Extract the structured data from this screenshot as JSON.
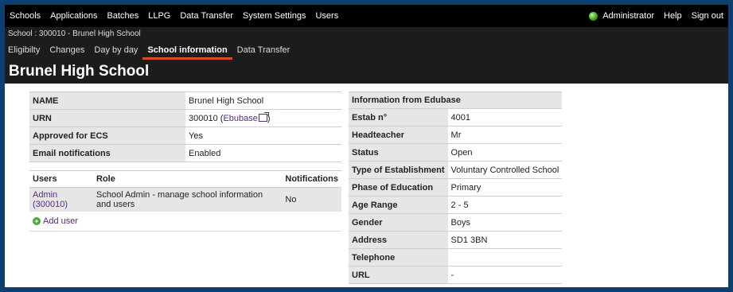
{
  "topnav": {
    "items": [
      "Schools",
      "Applications",
      "Batches",
      "LLPG",
      "Data Transfer",
      "System Settings",
      "Users"
    ],
    "user": "Administrator",
    "help": "Help",
    "signout": "Sign out"
  },
  "breadcrumb": "School : 300010 - Brunel High School",
  "tabs": [
    "Eligibilty",
    "Changes",
    "Day by day",
    "School information",
    "Data Transfer"
  ],
  "active_tab": "School information",
  "page_title": "Brunel High School",
  "school_info": [
    {
      "label": "NAME",
      "value": "Brunel High School"
    },
    {
      "label": "URN",
      "value": "300010"
    },
    {
      "label": "Approved for ECS",
      "value": "Yes"
    },
    {
      "label": "Email notifications",
      "value": "Enabled"
    }
  ],
  "urn_link": "Ebubase",
  "users_table": {
    "headers": [
      "Users",
      "Role",
      "Notifications"
    ],
    "rows": [
      {
        "user": "Admin (300010)",
        "role": "School Admin - manage school information and users",
        "notifications": "No"
      }
    ],
    "add_user": "Add user"
  },
  "edubase": {
    "title": "Information from Edubase",
    "rows": [
      {
        "label": "Estab n°",
        "value": "4001"
      },
      {
        "label": "Headteacher",
        "value": "Mr"
      },
      {
        "label": "Status",
        "value": "Open"
      },
      {
        "label": "Type of Establishment",
        "value": "Voluntary Controlled School"
      },
      {
        "label": "Phase of Education",
        "value": "Primary"
      },
      {
        "label": "Age Range",
        "value": "2 - 5"
      },
      {
        "label": "Gender",
        "value": "Boys"
      },
      {
        "label": "Address",
        "value": "SD1 3BN"
      },
      {
        "label": "Telephone",
        "value": ""
      },
      {
        "label": "URL",
        "value": "-"
      }
    ]
  },
  "colors": {
    "frame": "#0d3f73",
    "nav": "#000000",
    "header": "#1c1c1c",
    "accent": "#e0472a",
    "link": "#5a2a82",
    "status": "#3ea91d"
  }
}
